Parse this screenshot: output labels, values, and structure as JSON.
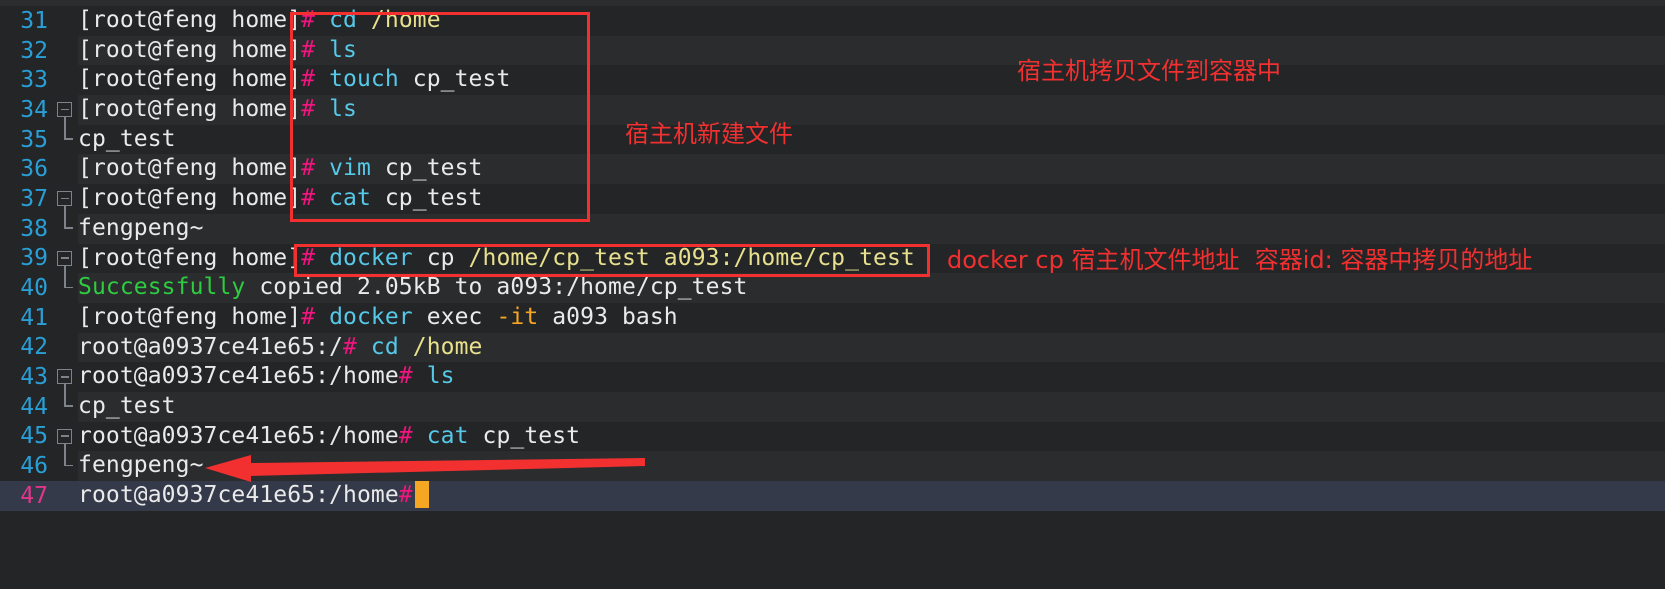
{
  "terminal": {
    "title": "docker cp terminal session",
    "colors": {
      "background": "#232527",
      "background_alt": "#2a2c2e",
      "active_line": "#343a4a",
      "lineno": "#2a9fd6",
      "lineno_active": "#e0368a",
      "prompt_hash": "#f2157f",
      "command": "#56c8e8",
      "path": "#e8e08c",
      "success": "#2ecc40",
      "flag": "#f5a623",
      "annotation": "#f23030",
      "cursor": "#f5a623"
    },
    "lines": [
      {
        "number": "31",
        "fold": "none",
        "segments": [
          {
            "text": "[root@feng home]",
            "cls": "t-white"
          },
          {
            "text": "#",
            "cls": "t-hash"
          },
          {
            "text": " ",
            "cls": "t-white"
          },
          {
            "text": "cd",
            "cls": "t-cmd"
          },
          {
            "text": " ",
            "cls": "t-white"
          },
          {
            "text": "/home",
            "cls": "t-path"
          }
        ]
      },
      {
        "number": "32",
        "fold": "none",
        "segments": [
          {
            "text": "[root@feng home]",
            "cls": "t-white"
          },
          {
            "text": "#",
            "cls": "t-hash"
          },
          {
            "text": " ",
            "cls": "t-white"
          },
          {
            "text": "ls",
            "cls": "t-cmd"
          }
        ]
      },
      {
        "number": "33",
        "fold": "none",
        "segments": [
          {
            "text": "[root@feng home]",
            "cls": "t-white"
          },
          {
            "text": "#",
            "cls": "t-hash"
          },
          {
            "text": " ",
            "cls": "t-white"
          },
          {
            "text": "touch",
            "cls": "t-cmd"
          },
          {
            "text": " cp_test",
            "cls": "t-white"
          }
        ]
      },
      {
        "number": "34",
        "fold": "open",
        "segments": [
          {
            "text": "[root@feng home]",
            "cls": "t-white"
          },
          {
            "text": "#",
            "cls": "t-hash"
          },
          {
            "text": " ",
            "cls": "t-white"
          },
          {
            "text": "ls",
            "cls": "t-cmd"
          }
        ]
      },
      {
        "number": "35",
        "fold": "end",
        "segments": [
          {
            "text": "cp_test",
            "cls": "t-white"
          }
        ]
      },
      {
        "number": "36",
        "fold": "none",
        "segments": [
          {
            "text": "[root@feng home]",
            "cls": "t-white"
          },
          {
            "text": "#",
            "cls": "t-hash"
          },
          {
            "text": " ",
            "cls": "t-white"
          },
          {
            "text": "vim",
            "cls": "t-cmd"
          },
          {
            "text": " cp_test",
            "cls": "t-white"
          }
        ]
      },
      {
        "number": "37",
        "fold": "open",
        "segments": [
          {
            "text": "[root@feng home]",
            "cls": "t-white"
          },
          {
            "text": "#",
            "cls": "t-hash"
          },
          {
            "text": " ",
            "cls": "t-white"
          },
          {
            "text": "cat",
            "cls": "t-cmd"
          },
          {
            "text": " cp_test",
            "cls": "t-white"
          }
        ]
      },
      {
        "number": "38",
        "fold": "end",
        "segments": [
          {
            "text": "fengpeng~",
            "cls": "t-white"
          }
        ]
      },
      {
        "number": "39",
        "fold": "open",
        "segments": [
          {
            "text": "[root@feng home]",
            "cls": "t-white"
          },
          {
            "text": "#",
            "cls": "t-hash"
          },
          {
            "text": " ",
            "cls": "t-white"
          },
          {
            "text": "docker",
            "cls": "t-cmd"
          },
          {
            "text": " cp ",
            "cls": "t-white"
          },
          {
            "text": "/home/cp_test a093:/home/cp_test",
            "cls": "t-path"
          }
        ]
      },
      {
        "number": "40",
        "fold": "end",
        "segments": [
          {
            "text": "Successfully",
            "cls": "t-green"
          },
          {
            "text": " copied 2.05kB to a093:/home/cp_test",
            "cls": "t-white"
          }
        ]
      },
      {
        "number": "41",
        "fold": "none",
        "segments": [
          {
            "text": "[root@feng home]",
            "cls": "t-white"
          },
          {
            "text": "#",
            "cls": "t-hash"
          },
          {
            "text": " ",
            "cls": "t-white"
          },
          {
            "text": "docker",
            "cls": "t-cmd"
          },
          {
            "text": " exec ",
            "cls": "t-white"
          },
          {
            "text": "-it",
            "cls": "t-orange"
          },
          {
            "text": " a093 bash",
            "cls": "t-white"
          }
        ]
      },
      {
        "number": "42",
        "fold": "none",
        "segments": [
          {
            "text": "root@a0937ce41e65:/",
            "cls": "t-white"
          },
          {
            "text": "#",
            "cls": "t-hash"
          },
          {
            "text": " ",
            "cls": "t-white"
          },
          {
            "text": "cd",
            "cls": "t-cmd"
          },
          {
            "text": " ",
            "cls": "t-white"
          },
          {
            "text": "/home",
            "cls": "t-path"
          }
        ]
      },
      {
        "number": "43",
        "fold": "open",
        "segments": [
          {
            "text": "root@a0937ce41e65:/home",
            "cls": "t-white"
          },
          {
            "text": "#",
            "cls": "t-hash"
          },
          {
            "text": " ",
            "cls": "t-white"
          },
          {
            "text": "ls",
            "cls": "t-cmd"
          }
        ]
      },
      {
        "number": "44",
        "fold": "end",
        "segments": [
          {
            "text": "cp_test",
            "cls": "t-white"
          }
        ]
      },
      {
        "number": "45",
        "fold": "open",
        "segments": [
          {
            "text": "root@a0937ce41e65:/home",
            "cls": "t-white"
          },
          {
            "text": "#",
            "cls": "t-hash"
          },
          {
            "text": " ",
            "cls": "t-white"
          },
          {
            "text": "cat",
            "cls": "t-cmd"
          },
          {
            "text": " cp_test",
            "cls": "t-white"
          }
        ]
      },
      {
        "number": "46",
        "fold": "end",
        "segments": [
          {
            "text": "fengpeng~",
            "cls": "t-white"
          }
        ]
      },
      {
        "number": "47",
        "fold": "none",
        "active": true,
        "cursor": true,
        "segments": [
          {
            "text": "root@a0937ce41e65:/home",
            "cls": "t-white"
          },
          {
            "text": "#",
            "cls": "t-hash"
          }
        ]
      }
    ]
  },
  "annotations": {
    "copy_to_container": "宿主机拷贝文件到容器中",
    "create_file_on_host": "宿主机新建文件",
    "docker_cp_syntax": "docker cp 宿主机文件地址  容器id: 容器中拷贝的地址"
  }
}
